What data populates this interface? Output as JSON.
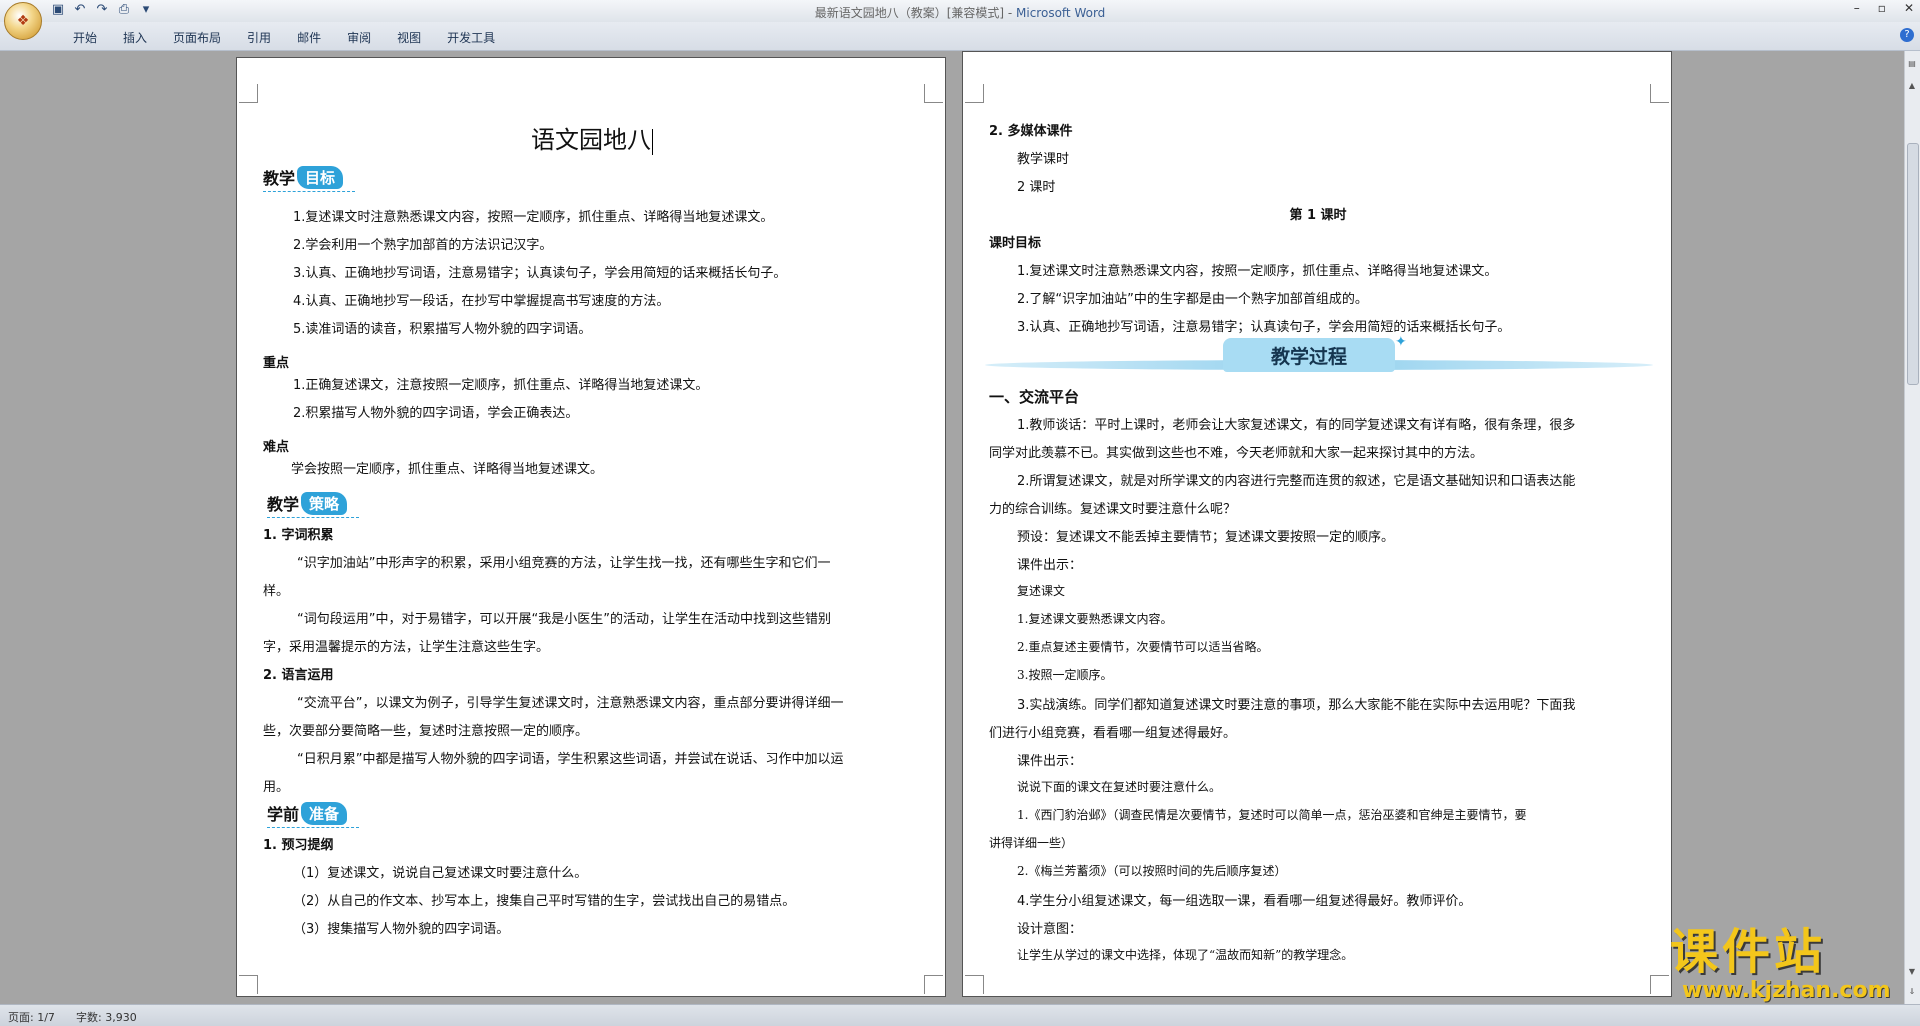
{
  "window": {
    "title": "最新语文园地八（教案）[兼容模式] - ",
    "app_name": "Microsoft Word"
  },
  "ribbon_tabs": [
    "开始",
    "插入",
    "页面布局",
    "引用",
    "邮件",
    "审阅",
    "视图",
    "开发工具"
  ],
  "page1": {
    "title": "语文园地八",
    "section_goal": {
      "prefix": "教学",
      "tag": "目标"
    },
    "goals": [
      "1.复述课文时注意熟悉课文内容，按照一定顺序，抓住重点、详略得当地复述课文。",
      "2.学会利用一个熟字加部首的方法识记汉字。",
      "3.认真、正确地抄写词语，注意易错字；认真读句子，学会用简短的话来概括长句子。",
      "4.认真、正确地抄写一段话，在抄写中掌握提高书写速度的方法。",
      "5.读准词语的读音，积累描写人物外貌的四字词语。"
    ],
    "key_heading": "重点",
    "key_points": [
      "1.正确复述课文，注意按照一定顺序，抓住重点、详略得当地复述课文。",
      "2.积累描写人物外貌的四字词语，学会正确表达。"
    ],
    "difficult_heading": "难点",
    "difficult_text": "学会按照一定顺序，抓住重点、详略得当地复述课文。",
    "section_strategy": {
      "prefix": "教学",
      "tag": "策略"
    },
    "strategy_1_heading": "1. 字词积累",
    "strategy_1_lines": [
      "“识字加油站”中形声字的积累，采用小组竞赛的方法，让学生找一找，还有哪些生字和它们一",
      "样。",
      "“词句段运用”中，对于易错字，可以开展“我是小医生”的活动，让学生在活动中找到这些错别",
      "字，采用温馨提示的方法，让学生注意这些生字。"
    ],
    "strategy_2_heading": "2. 语言运用",
    "strategy_2_lines": [
      "“交流平台”，以课文为例子，引导学生复述课文时，注意熟悉课文内容，重点部分要讲得详细一",
      "些，次要部分要简略一些，复述时注意按照一定的顺序。",
      "“日积月累”中都是描写人物外貌的四字词语，学生积累这些词语，并尝试在说话、习作中加以运",
      "用。"
    ],
    "section_prep": {
      "prefix": "学前",
      "tag": "准备"
    },
    "prep_heading": "1. 预习提纲",
    "prep_items": [
      "（1）复述课文，说说自己复述课文时要注意什么。",
      "（2）从自己的作文本、抄写本上，搜集自己平时写错的生字，尝试找出自己的易错点。",
      "（3）搜集描写人物外貌的四字词语。"
    ]
  },
  "page2": {
    "media_heading": "2. 多媒体课件",
    "class_hours_label": "教学课时",
    "class_hours_value": "2 课时",
    "lesson_title": "第 1 课时",
    "lesson_goal_heading": "课时目标",
    "lesson_goals": [
      "1.复述课文时注意熟悉课文内容，按照一定顺序，抓住重点、详略得当地复述课文。",
      "2.了解“识字加油站”中的生字都是由一个熟字加部首组成的。",
      "3.认真、正确地抄写词语，注意易错字；认真读句子，学会用简短的话来概括长句子。"
    ],
    "banner": "教学过程",
    "part1_heading": "一、交流平台",
    "body_lines": [
      "1.教师谈话：平时上课时，老师会让大家复述课文，有的同学复述课文有详有略，很有条理，很多",
      "同学对此羡慕不已。其实做到这些也不难，今天老师就和大家一起来探讨其中的方法。",
      "2.所谓复述课文，就是对所学课文的内容进行完整而连贯的叙述，它是语文基础知识和口语表达能",
      "力的综合训练。复述课文时要注意什么呢？",
      "预设：复述课文不能丢掉主要情节；复述课文要按照一定的顺序。",
      "课件出示：",
      "复述课文",
      "1.复述课文要熟悉课文内容。",
      "2.重点复述主要情节，次要情节可以适当省略。",
      "3.按照一定顺序。",
      "3.实战演练。同学们都知道复述课文时要注意的事项，那么大家能不能在实际中去运用呢？下面我",
      "们进行小组竞赛，看看哪一组复述得最好。",
      "课件出示：",
      "说说下面的课文在复述时要注意什么。",
      "1.《西门豹治邺》（调查民情是次要情节，复述时可以简单一点，惩治巫婆和官绅是主要情节，要",
      "讲得详细一些）",
      "2.《梅兰芳蓄须》（可以按照时间的先后顺序复述）",
      "4.学生分小组复述课文，每一组选取一课，看看哪一组复述得最好。教师评价。",
      "设计意图：",
      "让学生从学过的课文中选择，体现了“温故而知新”的教学理念。"
    ]
  },
  "status": {
    "page": "页面: 1/7",
    "words": "字数: 3,930"
  },
  "watermark": {
    "main": "课件站",
    "url": "www.kjzhan.com"
  },
  "colors": {
    "accent_tag": "#2ea2d9",
    "banner_bg": "#a8dcf3",
    "watermark": "#f3c61b"
  }
}
